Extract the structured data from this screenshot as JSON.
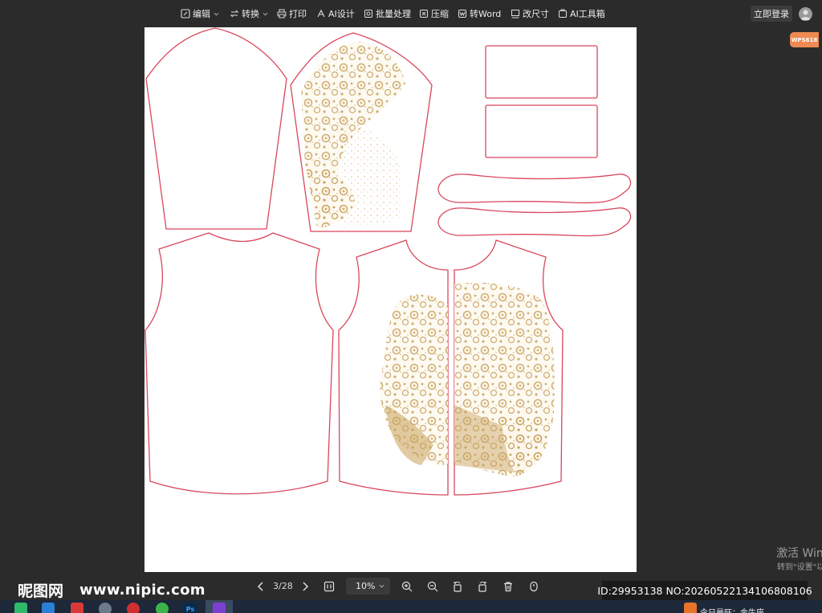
{
  "toolbar": {
    "edit": "编辑",
    "convert": "转换",
    "print": "打印",
    "ai_design": "AI设计",
    "batch": "批量处理",
    "compress": "压缩",
    "to_word": "转Word",
    "resize": "改尺寸",
    "ai_tools": "AI工具箱",
    "login": "立即登录",
    "promo_badge": "WPS618"
  },
  "document": {
    "content": "garment sewing pattern pieces: two sleeves, two rectangles, two curved bands, back panel, two front panels with gold leopard print"
  },
  "pagination": {
    "page_indicator": "3/28",
    "zoom": "10%"
  },
  "activation": {
    "title": "激活 Win",
    "subtitle": "转到\"设置\"以"
  },
  "watermark": {
    "logo": "昵图网",
    "url": "www.nipic.com",
    "id_text": "ID:29953138 NO:20260522134106808106"
  },
  "taskbar": {
    "news": "今日最旺：金牛座"
  },
  "colors": {
    "outline": "#d9465c",
    "print": "#c8a05a",
    "background": "#2b2b2b"
  }
}
